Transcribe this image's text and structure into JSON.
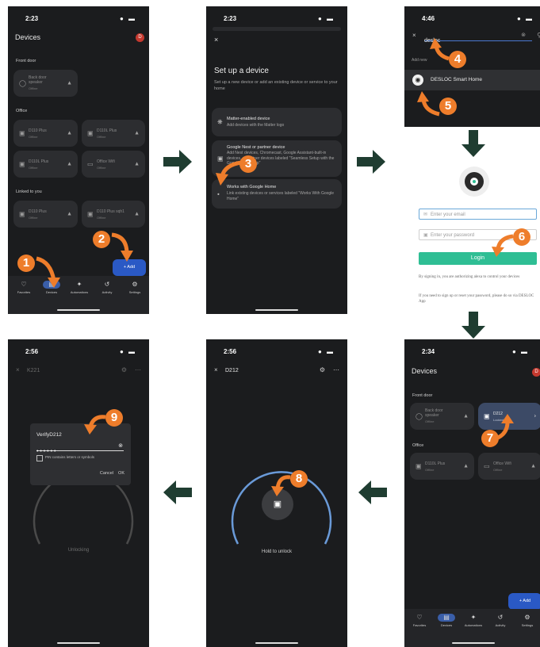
{
  "colors": {
    "badge": "#ee7d2b",
    "arrow": "#1f3d31",
    "accent": "#2a59c5",
    "login": "#2fbe94"
  },
  "screen1": {
    "time": "2:23",
    "title": "Devices",
    "avatar": "D",
    "sections": [
      {
        "label": "Front door",
        "tiles": [
          {
            "name": "Back door speaker",
            "status": "Offline",
            "icon": "speaker-icon"
          }
        ]
      },
      {
        "label": "Office",
        "tiles": [
          {
            "name": "D110 Plus",
            "status": "Offline",
            "icon": "lock-icon"
          },
          {
            "name": "D110L Plus",
            "status": "Offline",
            "icon": "lock-icon"
          },
          {
            "name": "D110L Plus",
            "status": "Offline",
            "icon": "lock-icon"
          },
          {
            "name": "Office Wifi",
            "status": "Offline",
            "icon": "router-icon"
          }
        ]
      },
      {
        "label": "Linked to you",
        "tiles": [
          {
            "name": "D110 Plus",
            "status": "Offline",
            "icon": "lock-icon"
          },
          {
            "name": "D110 Plus sqh1",
            "status": "Offline",
            "icon": "lock-icon"
          }
        ]
      }
    ],
    "add_label": "+ Add",
    "nav": [
      "Favorites",
      "Devices",
      "Automations",
      "Activity",
      "Settings"
    ]
  },
  "screen2": {
    "time": "2:23",
    "title": "Set up a device",
    "subtitle": "Set up a new device or add an existing device or service to your home",
    "options": [
      {
        "title": "Matter-enabled device",
        "desc": "Add devices with the Matter logo",
        "icon": "matter-icon"
      },
      {
        "title": "Google Nest or partner device",
        "desc": "Add Nest devices, Chromecast, Google Assistant-built-in devices, or partner devices labeled \"Seamless Setup with the Google Home app\"",
        "icon": "nest-device-icon"
      },
      {
        "title": "Works with Google Home",
        "desc": "Link existing devices or services labeled \"Works With Google Home\"",
        "icon": "google-home-icon"
      }
    ]
  },
  "screen3": {
    "time": "4:46",
    "search_value": "desloc",
    "add_new_label": "Add new",
    "result": "DESLOC Smart Home"
  },
  "screen4": {
    "email_placeholder": "Enter your email",
    "password_placeholder": "Enter your password",
    "login_label": "Login",
    "consent": "By signing in, you are authorizing alexa to control your devices",
    "signup_note": "If you need to sign up or reset your password, please do so via DESLOC App"
  },
  "screen5": {
    "time": "2:34",
    "title": "Devices",
    "avatar": "D",
    "sections": [
      {
        "label": "Front door",
        "tiles": [
          {
            "name": "Back door speaker",
            "status": "Offline",
            "icon": "speaker-icon"
          },
          {
            "name": "D212",
            "status": "Locked",
            "icon": "lock-icon"
          }
        ]
      },
      {
        "label": "Office",
        "tiles": [
          {
            "name": "D110L Plus",
            "status": "Offline",
            "icon": "lock-icon"
          },
          {
            "name": "Office Wifi",
            "status": "Offline",
            "icon": "router-icon"
          }
        ]
      }
    ],
    "add_label": "+ Add",
    "nav": [
      "Favorites",
      "Devices",
      "Automations",
      "Activity",
      "Settings"
    ]
  },
  "screen6": {
    "time": "2:56",
    "device": "D212",
    "hint": "Hold to unlock"
  },
  "screen7": {
    "time": "2:56",
    "device": "K221",
    "dialog_title": "VerifyD212",
    "pin_mask": "• • • • • •",
    "checkbox_label": "PIN contains letters or symbols",
    "cancel": "Cancel",
    "ok": "OK",
    "state": "Unlocking"
  },
  "steps": [
    "1",
    "2",
    "3",
    "4",
    "5",
    "6",
    "7",
    "8",
    "9"
  ]
}
